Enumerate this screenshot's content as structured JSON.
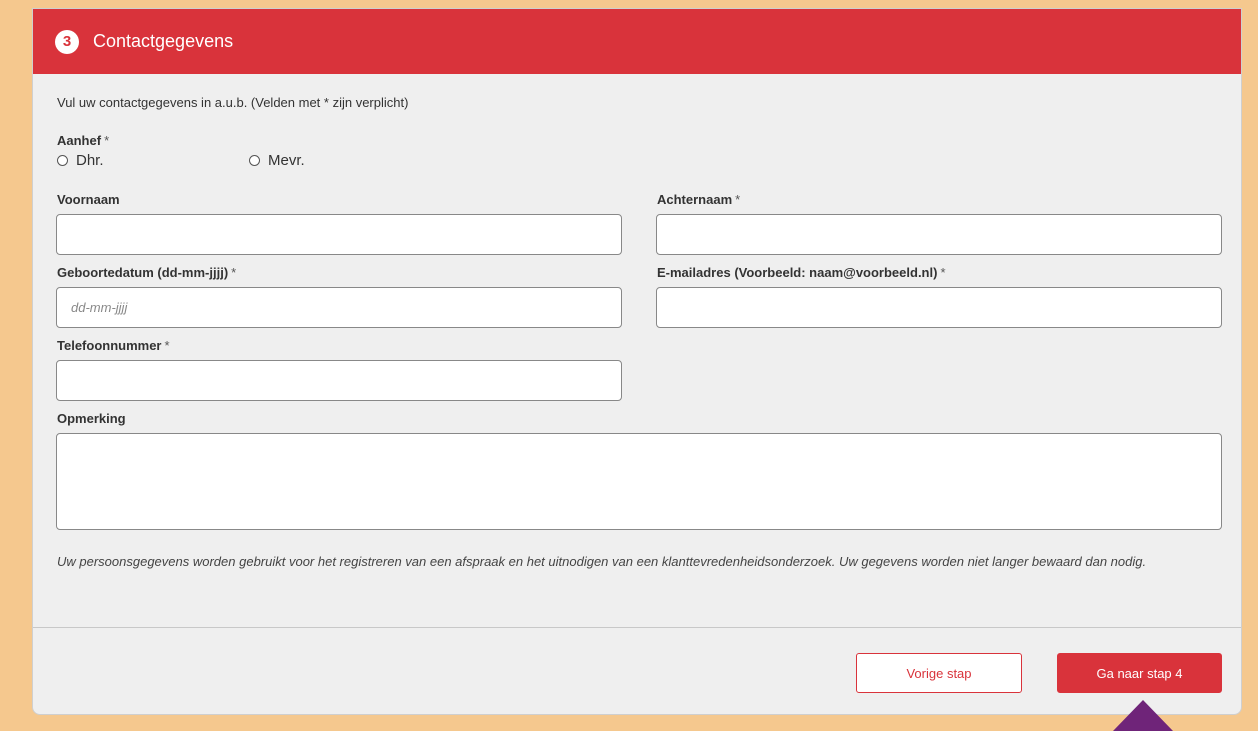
{
  "header": {
    "step_number": "3",
    "title": "Contactgegevens"
  },
  "intro": "Vul uw contactgegevens in a.u.b. (Velden met * zijn verplicht)",
  "salutation": {
    "label": "Aanhef",
    "required": "*",
    "options": [
      "Dhr.",
      "Mevr."
    ]
  },
  "fields": {
    "first_name": {
      "label": "Voornaam",
      "value": ""
    },
    "last_name": {
      "label": "Achternaam",
      "required": "*",
      "value": ""
    },
    "birth_date": {
      "label": "Geboortedatum (dd-mm-jjjj)",
      "required": "*",
      "placeholder": "dd-mm-jjjj",
      "value": ""
    },
    "email": {
      "label": "E-mailadres (Voorbeeld: naam@voorbeeld.nl)",
      "required": "*",
      "value": ""
    },
    "phone": {
      "label": "Telefoonnummer",
      "required": "*",
      "value": ""
    },
    "remark": {
      "label": "Opmerking",
      "value": ""
    }
  },
  "privacy_note": "Uw persoonsgegevens worden gebruikt voor het registreren van een afspraak en het uitnodigen van een klanttevredenheidsonderzoek. Uw gegevens worden niet langer bewaard dan nodig.",
  "buttons": {
    "previous": "Vorige stap",
    "next": "Ga naar stap 4"
  },
  "colors": {
    "accent": "#d9333b",
    "background": "#f5c88e",
    "panel": "#efefef",
    "marker": "#6f2479"
  }
}
